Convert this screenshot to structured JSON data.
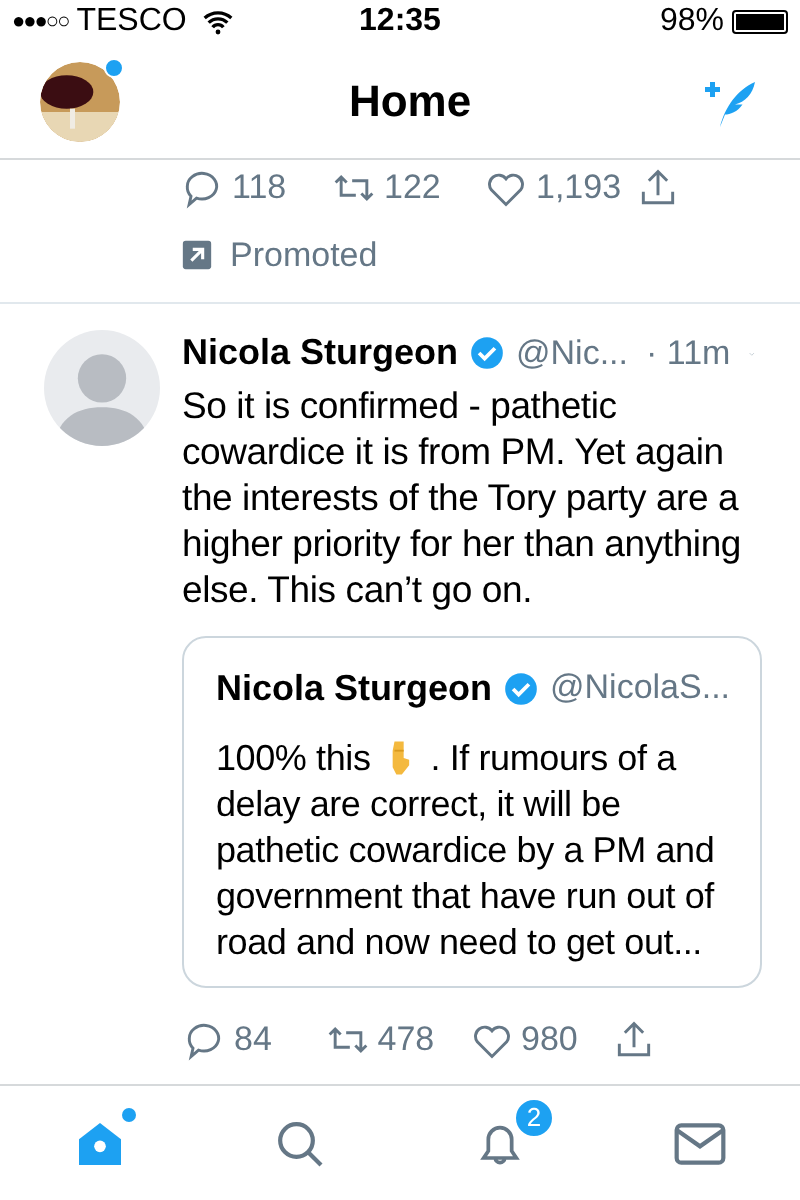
{
  "status_bar": {
    "signal": "●●●○○",
    "carrier": "TESCO",
    "time": "12:35",
    "battery": "98%"
  },
  "header": {
    "title": "Home",
    "profile_notification": true
  },
  "previous_tweet": {
    "actions": [
      {
        "kind": "reply",
        "count": "118"
      },
      {
        "kind": "retweet",
        "count": "122"
      },
      {
        "kind": "like",
        "count": "1,193"
      },
      {
        "kind": "share"
      }
    ],
    "promoted": "Promoted"
  },
  "tweet": {
    "name": "Nicola Sturgeon",
    "verified": true,
    "handle": "@Nic...",
    "time": "· 11m",
    "text": "So it is confirmed - pathetic cowardice it is from PM. Yet again the interests of the Tory party are a higher priority for her than anything else. This can’t go on.",
    "quote": {
      "name": "Nicola Sturgeon",
      "verified": true,
      "handle": "@NicolaS...",
      "text_before": "100% this",
      "text_after": ". If rumours of a",
      "text_rest": "delay are correct, it will be pathetic cowardice by a PM and government that have run out of road and now need to get out..."
    },
    "actions": [
      {
        "kind": "reply",
        "count": "84"
      },
      {
        "kind": "retweet",
        "count": "478"
      },
      {
        "kind": "like",
        "count": "980"
      },
      {
        "kind": "share"
      }
    ]
  },
  "tab_bar": [
    {
      "kind": "home",
      "selected": true,
      "dot": true
    },
    {
      "kind": "search",
      "selected": false
    },
    {
      "kind": "notifications",
      "selected": false,
      "badge": "2"
    },
    {
      "kind": "messages",
      "selected": false
    }
  ]
}
